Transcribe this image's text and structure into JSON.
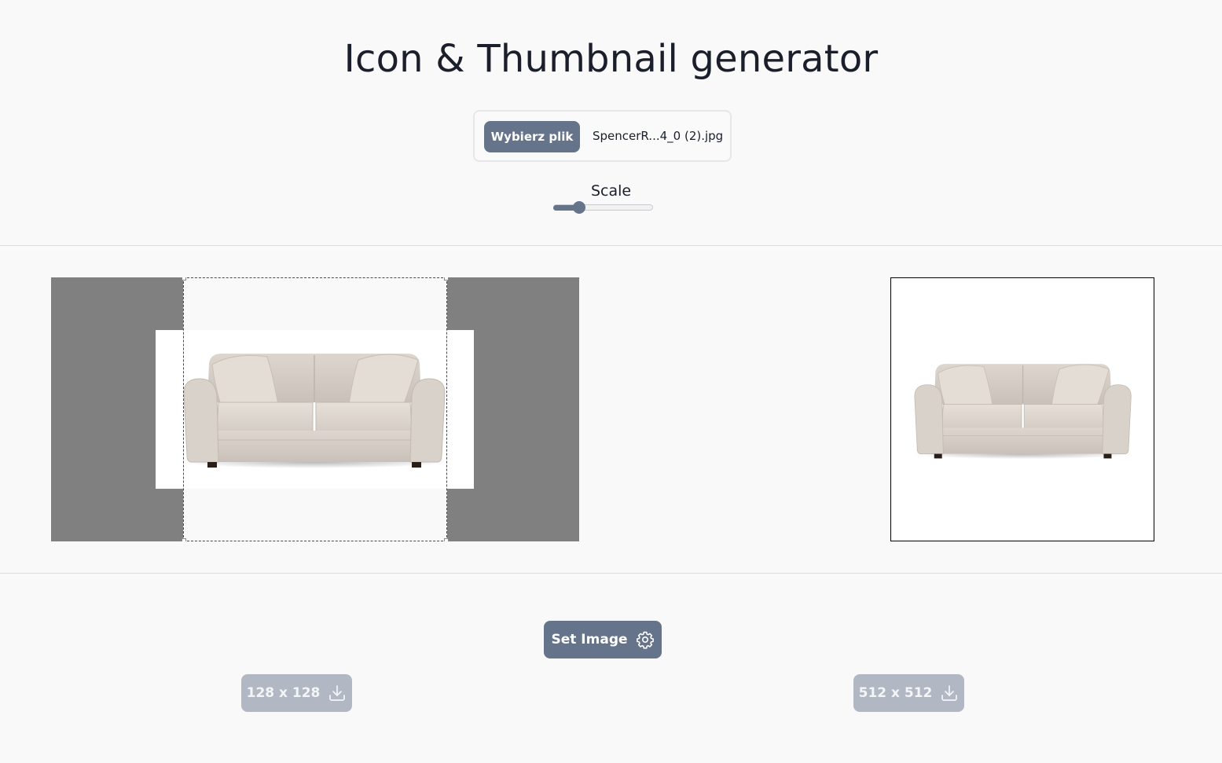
{
  "page": {
    "title": "Icon & Thumbnail generator"
  },
  "file_input": {
    "button_label": "Wybierz plik",
    "file_name": "SpencerR...4_0 (2).jpg"
  },
  "scale": {
    "label": "Scale",
    "value_fraction": 0.23
  },
  "cropper": {
    "image": "sofa-image"
  },
  "preview": {
    "image": "sofa-image"
  },
  "actions": {
    "set_image_label": "Set Image",
    "set_image_icon": "gear-icon",
    "download_small_label": "128 x 128",
    "download_large_label": "512 x 512",
    "download_icon": "download-icon"
  },
  "colors": {
    "accent": "#65748b",
    "disabled": "#b1b8c4",
    "crop_backdrop": "#808080"
  }
}
